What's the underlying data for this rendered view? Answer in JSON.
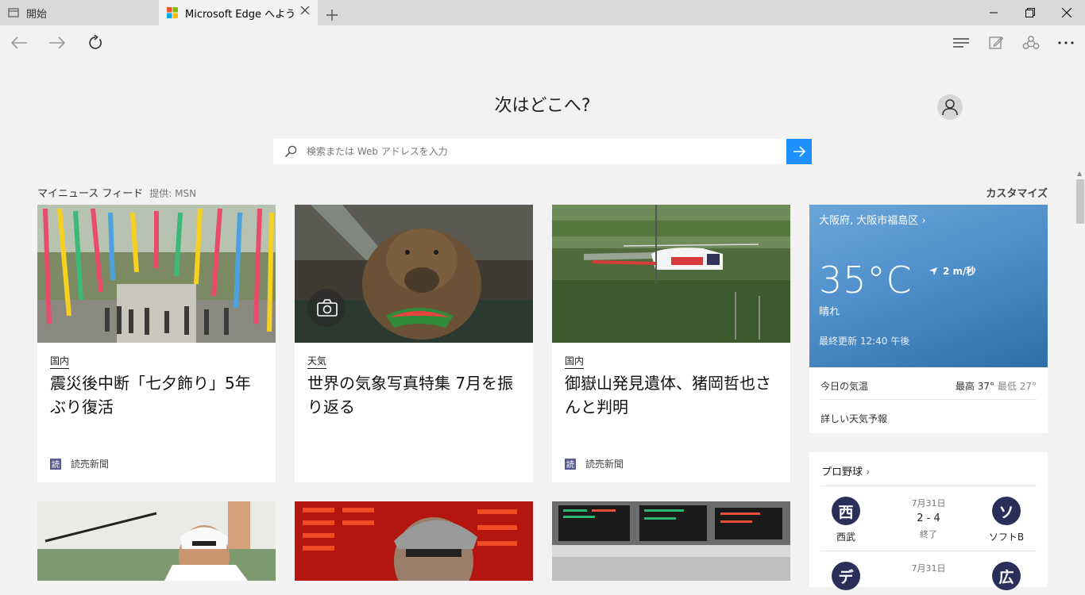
{
  "tabs": [
    {
      "label": "開始",
      "icon": "blank-page-icon"
    },
    {
      "label": "Microsoft Edge へようこそ",
      "icon": "microsoft-logo-icon"
    }
  ],
  "window_controls": [
    "minimize-icon",
    "restore-icon",
    "close-icon"
  ],
  "toolbar": {
    "left": [
      "back-arrow-icon",
      "forward-arrow-icon",
      "refresh-icon"
    ],
    "right": [
      "hub-icon",
      "web-note-icon",
      "share-icon",
      "more-icon"
    ]
  },
  "hero": {
    "heading": "次はどこへ?",
    "search_placeholder": "検索または Web アドレスを入力"
  },
  "feed": {
    "title": "マイニュース フィード",
    "provider": "提供: MSN",
    "customize": "カスタマイズ"
  },
  "cards": [
    {
      "category": "国内",
      "title": "震災後中断「七夕飾り」5年ぶり復活",
      "source": "読売新聞",
      "source_badge": "読"
    },
    {
      "category": "天気",
      "title": "世界の気象写真特集 7月を振り返る",
      "source": "",
      "source_badge": ""
    },
    {
      "category": "国内",
      "title": "御嶽山発見遺体、猪岡哲也さんと判明",
      "source": "読売新聞",
      "source_badge": "読"
    }
  ],
  "weather": {
    "location": "大阪府, 大阪市福島区",
    "temperature": "35°C",
    "condition": "晴れ",
    "wind": "2 m/秒",
    "updated": "最終更新 12:40 午後",
    "today_label": "今日の気温",
    "high_label": "最高",
    "high": "37°",
    "low_label": "最低",
    "low": "27°",
    "forecast_link": "詳しい天気予報"
  },
  "baseball": {
    "title": "プロ野球",
    "games": [
      {
        "home_logo": "西",
        "home": "西武",
        "date": "7月31日",
        "score": "2 - 4",
        "status": "終了",
        "away_logo": "ソ",
        "away": "ソフトB"
      },
      {
        "home_logo": "デ",
        "date": "7月31日",
        "away_logo": "広"
      }
    ]
  },
  "colors": {
    "accent": "#1e90ff",
    "weather_sky": "#4f8fcb",
    "team_logo": "#2a2f5a"
  }
}
